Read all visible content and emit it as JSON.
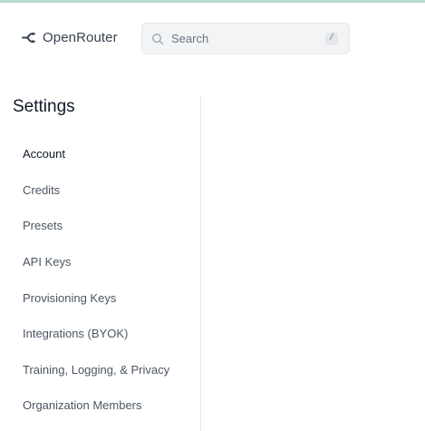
{
  "header": {
    "brand_name": "OpenRouter",
    "brand_icon": "openrouter-logo-icon",
    "search": {
      "placeholder": "Search",
      "value": "",
      "shortcut": "/"
    }
  },
  "settings": {
    "title": "Settings",
    "active_index": 0,
    "items": [
      {
        "label": "Account"
      },
      {
        "label": "Credits"
      },
      {
        "label": "Presets"
      },
      {
        "label": "API Keys"
      },
      {
        "label": "Provisioning Keys"
      },
      {
        "label": "Integrations (BYOK)"
      },
      {
        "label": "Training, Logging, & Privacy"
      },
      {
        "label": "Organization Members"
      }
    ]
  },
  "colors": {
    "top_border": "#b9d9d3",
    "text_primary": "#111827",
    "text_secondary": "#4b5563",
    "search_bg": "#f3f4f6"
  }
}
